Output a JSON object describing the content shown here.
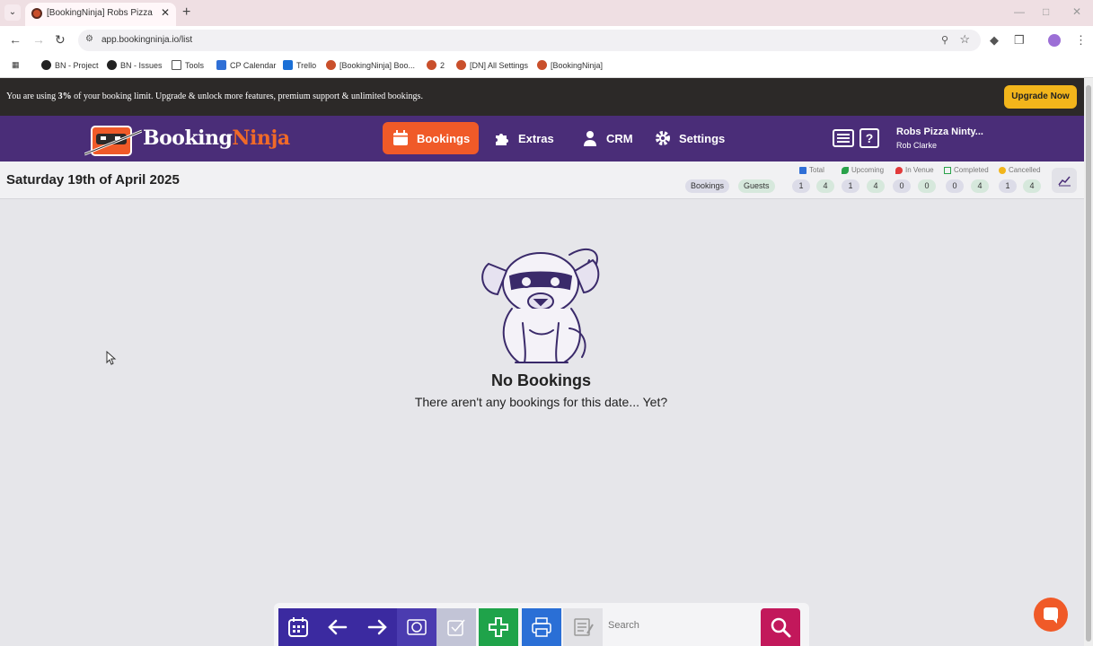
{
  "browser": {
    "tab_title": "[BookingNinja] Robs Pizza Ninty...",
    "url": "app.bookingninja.io/list",
    "bookmarks": [
      {
        "label": "BN - Project",
        "icon": "github-icon"
      },
      {
        "label": "BN - Issues",
        "icon": "github-icon"
      },
      {
        "label": "Tools",
        "icon": "folder-icon"
      },
      {
        "label": "CP Calendar",
        "icon": "calendar-icon"
      },
      {
        "label": "Trello",
        "icon": "trello-icon"
      },
      {
        "label": "[BookingNinja] Boo...",
        "icon": "bookingninja-icon"
      },
      {
        "label": "2",
        "icon": "bookingninja-icon"
      },
      {
        "label": "[DN] All Settings",
        "icon": "bookingninja-icon"
      },
      {
        "label": "[BookingNinja]",
        "icon": "bookingninja-icon"
      }
    ]
  },
  "banner": {
    "prefix": "You are using ",
    "percent": "3%",
    "suffix": " of your booking limit. Upgrade & unlock more features, premium support & unlimited bookings.",
    "upgrade_label": "Upgrade Now"
  },
  "header": {
    "logo_text_a": "Booking",
    "logo_text_b": "Ninja",
    "nav": [
      {
        "label": "Bookings",
        "icon": "calendar-icon",
        "active": true
      },
      {
        "label": "Extras",
        "icon": "puzzle-icon",
        "active": false
      },
      {
        "label": "CRM",
        "icon": "user-icon",
        "active": false
      },
      {
        "label": "Settings",
        "icon": "gear-icon",
        "active": false
      }
    ],
    "venue_name": "Robs Pizza Ninty...",
    "user_name": "Rob Clarke"
  },
  "datebar": {
    "date": "Saturday 19th of April 2025",
    "row_labels": [
      "Bookings",
      "Guests"
    ],
    "stats": [
      {
        "label": "Total",
        "bookings": "1",
        "guests": "4",
        "color": "#2f6fd6"
      },
      {
        "label": "Upcoming",
        "bookings": "1",
        "guests": "4",
        "color": "#2aa24a"
      },
      {
        "label": "In Venue",
        "bookings": "0",
        "guests": "0",
        "color": "#e23a3a"
      },
      {
        "label": "Completed",
        "bookings": "0",
        "guests": "4",
        "color": "#2aa24a"
      },
      {
        "label": "Cancelled",
        "bookings": "1",
        "guests": "4",
        "color": "#f2b51b"
      }
    ]
  },
  "empty_state": {
    "title": "No Bookings",
    "subtitle": "There aren't any bookings for this date... Yet?"
  },
  "toolbar": {
    "search_placeholder": "Search",
    "colors": {
      "calendar": "#3b2aa0",
      "prev": "#3b2aa0",
      "next": "#3b2aa0",
      "view": "#4b3cb0",
      "check": "#c2c4d6",
      "add": "#1fa34a",
      "print": "#2a6fd6",
      "notes": "#e2e2e6",
      "search": "#c2185b"
    }
  },
  "colors": {
    "header_bg": "#4a2d78",
    "accent": "#f05a28",
    "banner_bg": "#2c2928",
    "upgrade": "#f2b51b"
  }
}
